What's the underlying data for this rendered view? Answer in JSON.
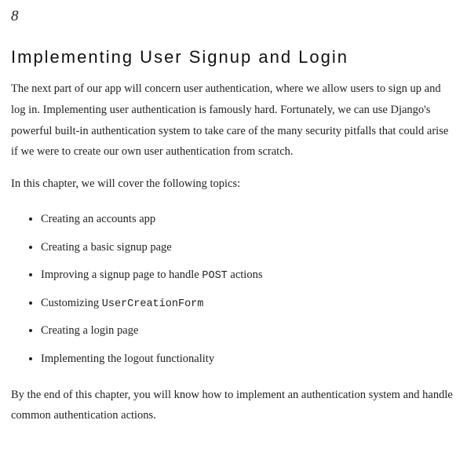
{
  "chapter": {
    "number": "8",
    "title": "Implementing User Signup and Login",
    "intro": "The next part of our app will concern user authentication, where we allow users to sign up and log in. Implementing user authentication is famously hard. Fortunately, we can use Django's powerful built-in authentication system to take care of the many security pitfalls that could arise if we were to create our own user authentication from scratch.",
    "topics_intro": "In this chapter, we will cover the following topics:",
    "topics": [
      {
        "pre": "Creating an accounts app",
        "code": "",
        "post": ""
      },
      {
        "pre": "Creating a basic signup page",
        "code": "",
        "post": ""
      },
      {
        "pre": "Improving a signup page to handle ",
        "code": "POST",
        "post": " actions"
      },
      {
        "pre": "Customizing ",
        "code": "UserCreationForm",
        "post": ""
      },
      {
        "pre": "Creating a login page",
        "code": "",
        "post": ""
      },
      {
        "pre": "Implementing the logout functionality",
        "code": "",
        "post": ""
      }
    ],
    "outro": "By the end of this chapter, you will know how to implement an authentication system and handle common authentication actions."
  }
}
